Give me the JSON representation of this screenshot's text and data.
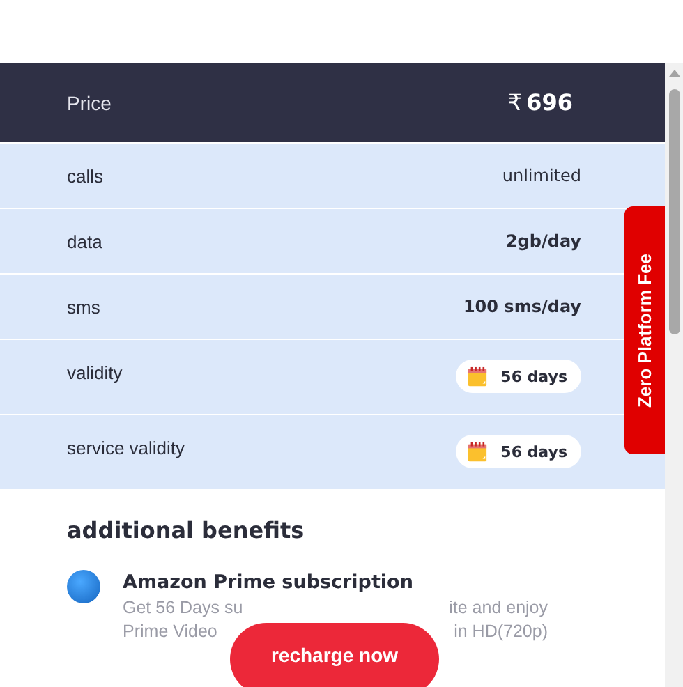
{
  "plan_table": {
    "header": {
      "label": "Price",
      "currency": "₹",
      "value": "696"
    },
    "rows": [
      {
        "kind": "text",
        "label": "calls",
        "value": "unlimited",
        "bold": false
      },
      {
        "kind": "text",
        "label": "data",
        "value": "2gb/day",
        "bold": true
      },
      {
        "kind": "text",
        "label": "sms",
        "value": "100 sms/day",
        "bold": true
      },
      {
        "kind": "pill",
        "label": "validity",
        "value": "56 days"
      },
      {
        "kind": "pill",
        "label": "service validity",
        "value": "56 days"
      }
    ]
  },
  "side_tab": {
    "label": "Zero Platform Fee"
  },
  "additional_benefits": {
    "title": "additional benefits",
    "items": [
      {
        "title": "Amazon Prime subscription",
        "lines": [
          {
            "left": "Get 56 Days su",
            "right": "ite and enjoy"
          },
          {
            "left": "Prime Video",
            "right": "in HD(720p)"
          }
        ]
      }
    ]
  },
  "action_button": {
    "label": "recharge now"
  }
}
